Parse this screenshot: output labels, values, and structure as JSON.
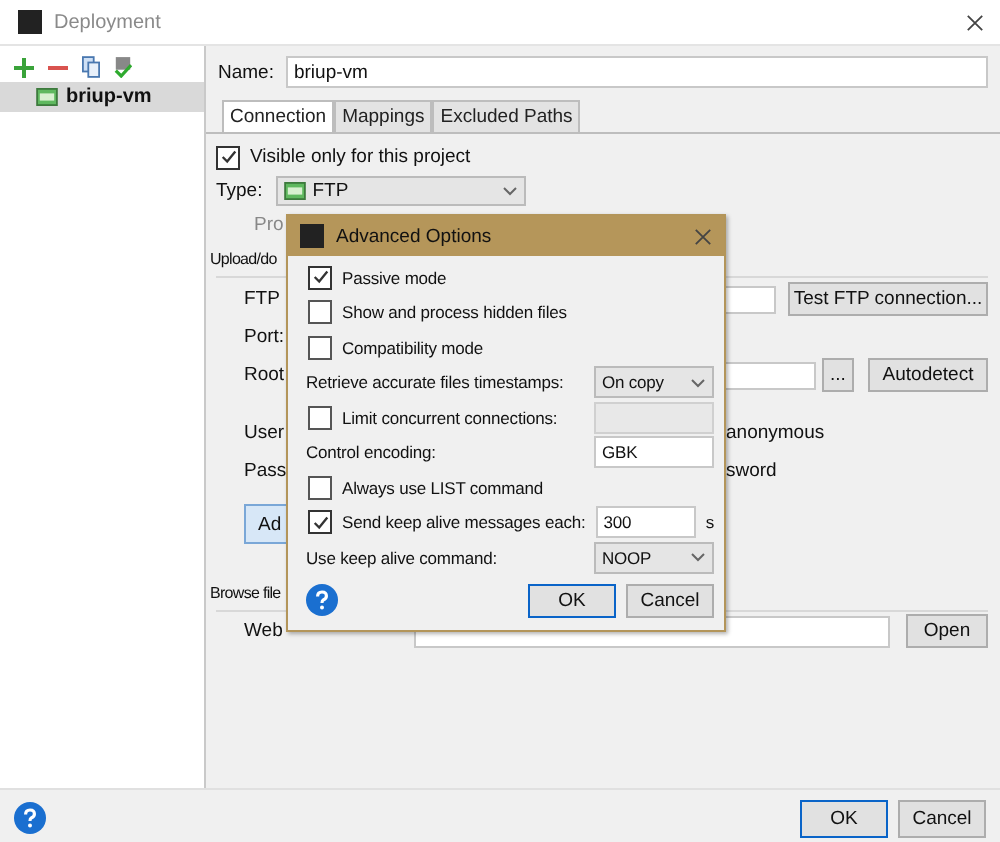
{
  "window": {
    "title": "Deployment"
  },
  "sidebar": {
    "items": [
      {
        "label": "briup-vm",
        "selected": true
      }
    ]
  },
  "name_field": {
    "label": "Name:",
    "value": "briup-vm"
  },
  "tabs": [
    {
      "label": "Connection",
      "selected": true
    },
    {
      "label": "Mappings",
      "selected": false
    },
    {
      "label": "Excluded Paths",
      "selected": false
    }
  ],
  "connection": {
    "visible_only": {
      "label": "Visible only for this project",
      "checked": true
    },
    "type": {
      "label": "Type:",
      "value": "FTP"
    },
    "hint": "Pro",
    "upload_section": "Upload/do",
    "ftp_host": {
      "label": "FTP",
      "button": "Test FTP connection..."
    },
    "port": {
      "label": "Port:"
    },
    "root_path": {
      "label": "Root",
      "browse": "...",
      "button": "Autodetect"
    },
    "user_name": {
      "label": "User",
      "trailing": "anonymous"
    },
    "password": {
      "label": "Pass",
      "trailing": "sword"
    },
    "advanced_button": "Ad",
    "browse_section": "Browse file",
    "web_url": {
      "label": "Web",
      "button": "Open"
    }
  },
  "buttons": [
    {
      "label": "OK",
      "default": true
    },
    {
      "label": "Cancel",
      "default": false
    }
  ],
  "dialog": {
    "title": "Advanced Options",
    "items": [
      {
        "kind": "checkbox",
        "label": "Passive mode",
        "checked": true
      },
      {
        "kind": "checkbox",
        "label": "Show and process hidden files",
        "checked": false
      },
      {
        "kind": "checkbox",
        "label": "Compatibility mode",
        "checked": false
      },
      {
        "kind": "select",
        "label": "Retrieve accurate files timestamps:",
        "value": "On copy"
      },
      {
        "kind": "checkbox-field",
        "label": "Limit concurrent connections:",
        "checked": false,
        "disabled": true
      },
      {
        "kind": "field",
        "label": "Control encoding:",
        "value": "GBK"
      },
      {
        "kind": "checkbox",
        "label": "Always use LIST command",
        "checked": false
      },
      {
        "kind": "checkbox-field",
        "label": "Send keep alive messages each:",
        "checked": true,
        "value": "300",
        "unit": "s"
      },
      {
        "kind": "select",
        "label": "Use keep alive command:",
        "value": "NOOP"
      }
    ],
    "buttons": [
      {
        "label": "OK",
        "default": true
      },
      {
        "label": "Cancel",
        "default": false
      }
    ]
  }
}
